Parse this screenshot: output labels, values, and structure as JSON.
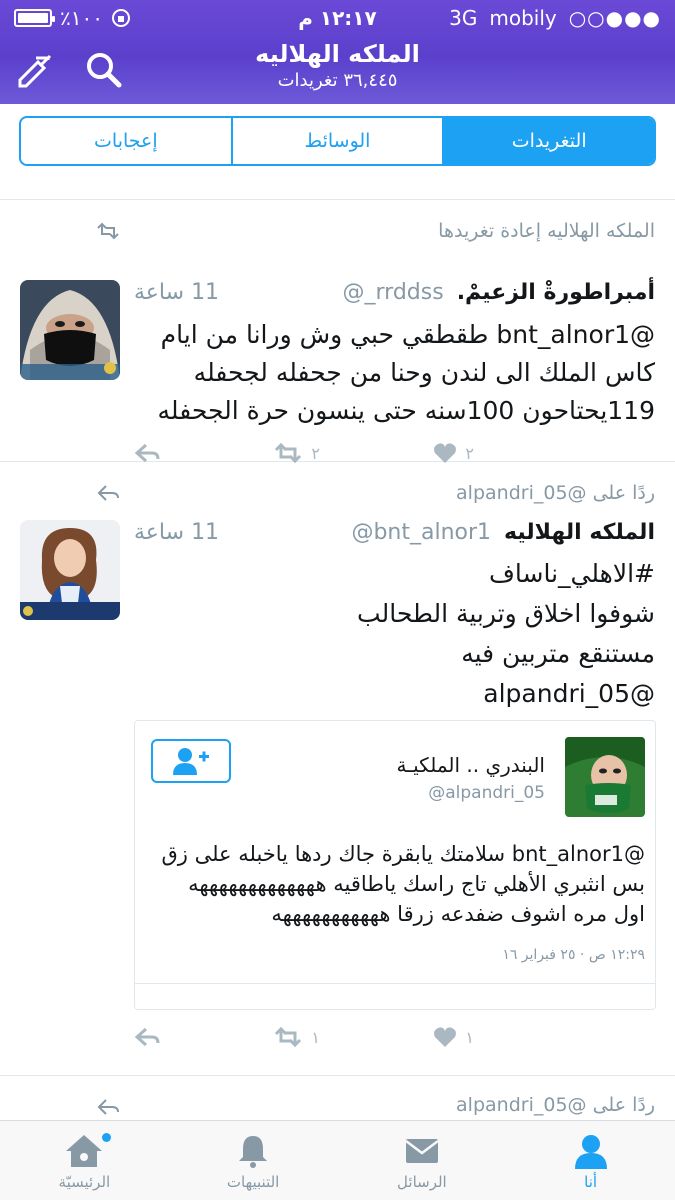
{
  "status": {
    "battery": "٪١٠٠",
    "time": "١٢:١٧ م",
    "network": "3G",
    "carrier": "mobily",
    "signal": "○○●●●"
  },
  "profile": {
    "name": "الملكه الهلاليه",
    "tweet_count": "٣٦,٤٤٥ تغريدات"
  },
  "tabs": [
    "إعجابات",
    "الوسائط",
    "التغريدات"
  ],
  "tweets": [
    {
      "context": "الملكه الهلاليه إعادة تغريدها",
      "name": "أمبراطورةْ الزعيمْ.",
      "handle": "@_rrddss",
      "time": "11 ساعة",
      "text": "@bnt_alnor1  طقطقي حبي وش ورانا من ايام\nكاس الملك الى لندن  وحنا من جحفله لجحفله\n119يحتاحون 100سنه حتى ينسون حرة الجحفله",
      "retweets": "٢",
      "likes": "٢"
    },
    {
      "context": "ردًا على @alpandri_05",
      "name": "الملكه الهلاليه",
      "handle": "@bnt_alnor1",
      "time": "11 ساعة",
      "text": "#الاهلي_ناساف\nشوفوا اخلاق وتربية الطحالب\nمستنقع متربين فيه\n@alpandri_05",
      "retweets": "١",
      "likes": "١",
      "quote": {
        "name": "البندري .. الملكيـة",
        "handle": "@alpandri_05",
        "text": "@bnt_alnor1 سلامتك يابقرة جاك ردها ياخبله على زق\nبس انثبري الأهلي تاج راسك ياطاقيه هههههههههههههه\nاول مره اشوف ضفدعه زرقا هههههههههههه",
        "date": "١٢:٢٩ ص · ٢٥ فبراير ١٦"
      }
    },
    {
      "context": "ردًا على @alpandri_05"
    }
  ],
  "tabbar": [
    "الرئيسيّة",
    "التنبيهات",
    "الرسائل",
    "أنا"
  ],
  "colors": {
    "accent": "#1da1f2",
    "header": "#5b40cc"
  }
}
